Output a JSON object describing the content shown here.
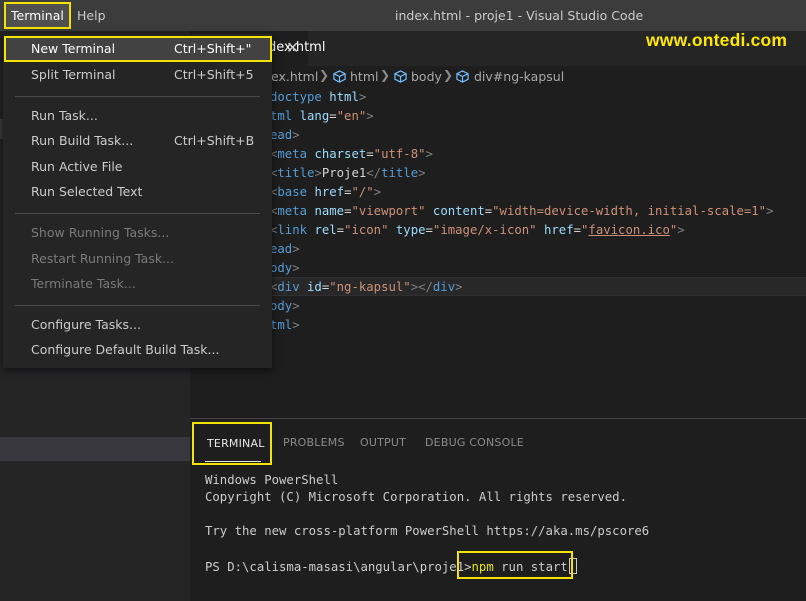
{
  "menubar": {
    "terminal": "Terminal",
    "help": "Help"
  },
  "window_title": "index.html - proje1 - Visual Studio Code",
  "watermark": "www.ontedi.com",
  "tab": {
    "label": "index.html",
    "label_visible": "dex.html",
    "close_glyph": "✕"
  },
  "breadcrumb": {
    "file": "ex.html",
    "items": [
      "html",
      "body",
      "div#ng-kapsul"
    ],
    "sep": "❯"
  },
  "editor": {
    "lines": [
      "doctype html>",
      "tml lang=\"en\">",
      "ead>",
      "<meta charset=\"utf-8\">",
      "<title>Proje1</title>",
      "<base href=\"/\">",
      "<meta name=\"viewport\" content=\"width=device-width, initial-scale=1\">",
      "<link rel=\"icon\" type=\"image/x-icon\" href=\"favicon.ico\">",
      "ead>",
      "ody>",
      "<div id=\"ng-kapsul\"></div>",
      "ody>",
      "tml>"
    ]
  },
  "terminal_menu": {
    "items": [
      {
        "label": "New Terminal",
        "shortcut": "Ctrl+Shift+\"",
        "state": "selected"
      },
      {
        "label": "Split Terminal",
        "shortcut": "Ctrl+Shift+5",
        "state": "enabled"
      },
      {
        "label": "Run Task...",
        "shortcut": "",
        "state": "enabled"
      },
      {
        "label": "Run Build Task...",
        "shortcut": "Ctrl+Shift+B",
        "state": "enabled"
      },
      {
        "label": "Run Active File",
        "shortcut": "",
        "state": "enabled"
      },
      {
        "label": "Run Selected Text",
        "shortcut": "",
        "state": "enabled"
      },
      {
        "label": "Show Running Tasks...",
        "shortcut": "",
        "state": "disabled"
      },
      {
        "label": "Restart Running Task...",
        "shortcut": "",
        "state": "disabled"
      },
      {
        "label": "Terminate Task...",
        "shortcut": "",
        "state": "disabled"
      },
      {
        "label": "Configure Tasks...",
        "shortcut": "",
        "state": "enabled"
      },
      {
        "label": "Configure Default Build Task...",
        "shortcut": "",
        "state": "enabled"
      }
    ]
  },
  "panel": {
    "tabs": [
      "TERMINAL",
      "PROBLEMS",
      "OUTPUT",
      "DEBUG CONSOLE"
    ],
    "active_tab": "TERMINAL"
  },
  "terminal": {
    "line1": "Windows PowerShell",
    "line2": "Copyright (C) Microsoft Corporation. All rights reserved.",
    "line3": "Try the new cross-platform PowerShell https://aka.ms/pscore6",
    "prompt": "PS D:\\calisma-masasi\\angular\\proje1>",
    "cmd_npm": "npm",
    "cmd_rest": " run start"
  },
  "colors": {
    "highlight_box": "#f2e205",
    "watermark": "#ffe800",
    "tag": "#569cd6",
    "attribute": "#9cdcfe",
    "string": "#ce9178"
  }
}
